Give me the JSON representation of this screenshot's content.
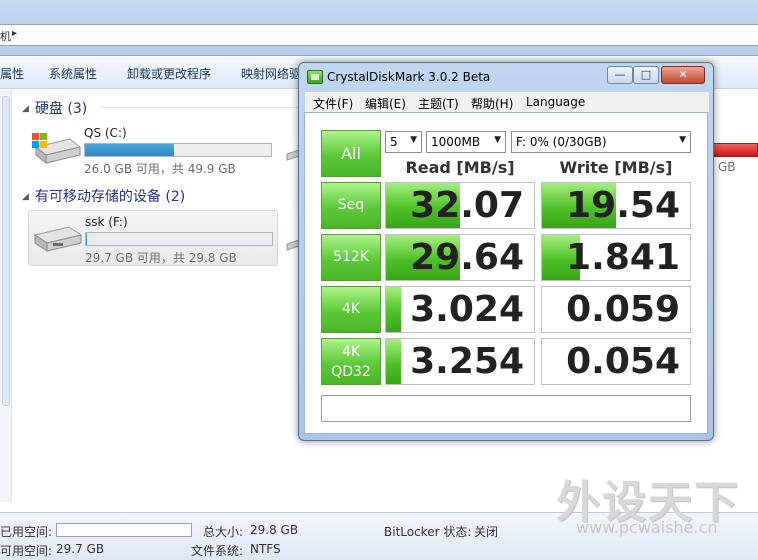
{
  "explorer": {
    "address_fragment": "机",
    "toolbar": {
      "properties": "属性",
      "system_properties": "系统属性",
      "uninstall": "卸载或更改程序",
      "map_drive": "映射网络驱"
    },
    "hard_disks": {
      "header": "硬盘 (3)",
      "drives": [
        {
          "name": "QS (C:)",
          "free_text": "26.0 GB 可用，共 49.9 GB",
          "used_fraction": 0.479
        }
      ],
      "partial_free_text": "GB"
    },
    "removable": {
      "header": "有可移动存储的设备 (2)",
      "drives": [
        {
          "name": "ssk (F:)",
          "free_text": "29.7 GB 可用，共 29.8 GB",
          "used_fraction": 0.003
        }
      ]
    },
    "status_bar": {
      "used_space_label": "已用空间:",
      "free_space_label": "可用空间:",
      "free_space_value": "29.7 GB",
      "total_size_label": "总大小:",
      "total_size_value": "29.8 GB",
      "filesystem_label": "文件系统:",
      "filesystem_value": "NTFS",
      "bitlocker_label": "BitLocker 状态:",
      "bitlocker_value": "关闭"
    }
  },
  "cdm": {
    "title": "CrystalDiskMark 3.0.2 Beta",
    "window_buttons": {
      "minimize": "—",
      "maximize": "□",
      "close": "✕"
    },
    "menu": [
      "文件(F)",
      "编辑(E)",
      "主题(T)",
      "帮助(H)",
      "Language"
    ],
    "all_button": "All",
    "count_select": "5",
    "size_select": "1000MB",
    "drive_select": "F: 0% (0/30GB)",
    "read_header": "Read [MB/s]",
    "write_header": "Write [MB/s]",
    "rows": [
      {
        "label": "Seq",
        "read": "32.07",
        "write": "19.54",
        "read_fill": 0.5,
        "write_fill": 0.5
      },
      {
        "label": "512K",
        "read": "29.64",
        "write": "1.841",
        "read_fill": 0.5,
        "write_fill": 0.26
      },
      {
        "label": "4K",
        "read": "3.024",
        "write": "0.059",
        "read_fill": 0.1,
        "write_fill": 0.0
      },
      {
        "label": "4K\nQD32",
        "label_line1": "4K",
        "label_line2": "QD32",
        "read": "3.254",
        "write": "0.054",
        "read_fill": 0.1,
        "write_fill": 0.0
      }
    ],
    "comment": ""
  },
  "watermark": {
    "brand": "外设天下",
    "url": "www.pcwaishe.cn"
  },
  "colors": {
    "cdm_green": "#4fc12a",
    "usage_bar_blue": "#2a8bc6",
    "section_header_text": "#1e3287",
    "close_button_red": "#c4492e"
  }
}
